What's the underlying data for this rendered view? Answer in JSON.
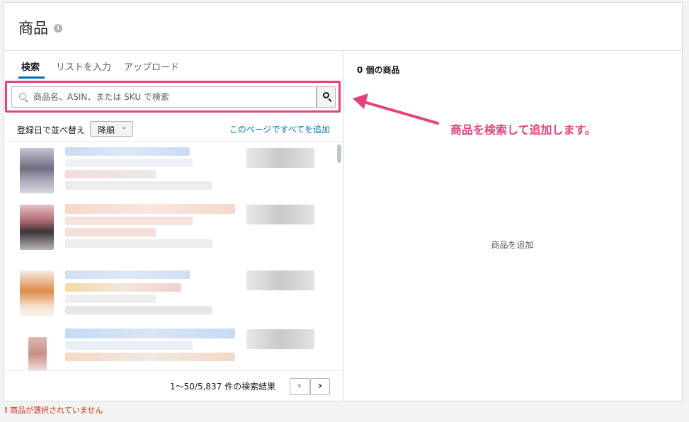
{
  "header": {
    "title": "商品",
    "info_icon": "info-icon"
  },
  "tabs": [
    {
      "label": "検索",
      "active": true
    },
    {
      "label": "リストを入力",
      "active": false
    },
    {
      "label": "アップロード",
      "active": false
    }
  ],
  "search": {
    "placeholder": "商品名、ASIN、または SKU で検索",
    "value": "",
    "button_icon": "search-icon"
  },
  "sort": {
    "label": "登録日で並べ替え",
    "selected": "降順"
  },
  "add_all_link": "このページですべてを追加",
  "results": {
    "count_text": "1〜50/5,837 件の検索結果",
    "prev_label": "‹",
    "next_label": "›"
  },
  "selected_panel": {
    "count_label": "0 個の商品",
    "empty_label": "商品を追加"
  },
  "annotation": {
    "text": "商品を検索して追加します。",
    "color": "#e8407c"
  },
  "error": {
    "text": "商品が選択されていません",
    "color": "#d13212"
  },
  "colors": {
    "accent": "#0073bb",
    "highlight": "#e8407c",
    "error": "#d13212"
  }
}
